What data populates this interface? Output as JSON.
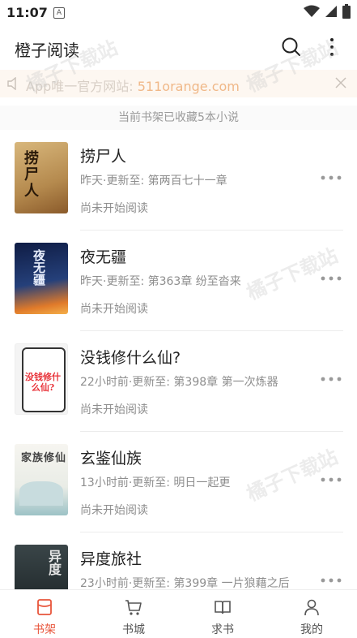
{
  "status_bar": {
    "time": "11:07",
    "notification_badge": "A"
  },
  "app_bar": {
    "title": "橙子阅读"
  },
  "notice": {
    "prefix": "App唯一官方网站: ",
    "link": "511orange.com"
  },
  "shelf": {
    "count_text": "当前书架已收藏5本小说"
  },
  "books": [
    {
      "title": "捞尸人",
      "update": "昨天·更新至: 第两百七十一章",
      "status": "尚未开始阅读",
      "cover_text": "捞尸人",
      "cover_colors": [
        "#c9a56a",
        "#8a5a2a"
      ]
    },
    {
      "title": "夜无疆",
      "update": "昨天·更新至: 第363章 纷至沓来",
      "status": "尚未开始阅读",
      "cover_text": "夜无疆",
      "cover_colors": [
        "#1b2c5e",
        "#e07a2a"
      ]
    },
    {
      "title": "没钱修什么仙?",
      "update": "22小时前·更新至: 第398章 第一次炼器",
      "status": "尚未开始阅读",
      "cover_text": "没钱修什么仙?",
      "cover_colors": [
        "#f4f4f4",
        "#e8333a"
      ]
    },
    {
      "title": "玄鉴仙族",
      "update": "13小时前·更新至: 明日一起更",
      "status": "尚未开始阅读",
      "cover_text": "家族修仙",
      "cover_colors": [
        "#f2f1ec",
        "#6aa0a6"
      ]
    },
    {
      "title": "异度旅社",
      "update": "23小时前·更新至: 第399章 一片狼藉之后",
      "status": "",
      "cover_text": "异度",
      "cover_colors": [
        "#2a3538",
        "#111"
      ]
    }
  ],
  "bottom_nav": [
    {
      "label": "书架",
      "icon": "bookshelf-icon",
      "active": true
    },
    {
      "label": "书城",
      "icon": "store-cart-icon",
      "active": false
    },
    {
      "label": "求书",
      "icon": "open-book-icon",
      "active": false
    },
    {
      "label": "我的",
      "icon": "person-icon",
      "active": false
    }
  ],
  "colors": {
    "accent": "#e8553b",
    "notice_link": "#f0b888"
  }
}
